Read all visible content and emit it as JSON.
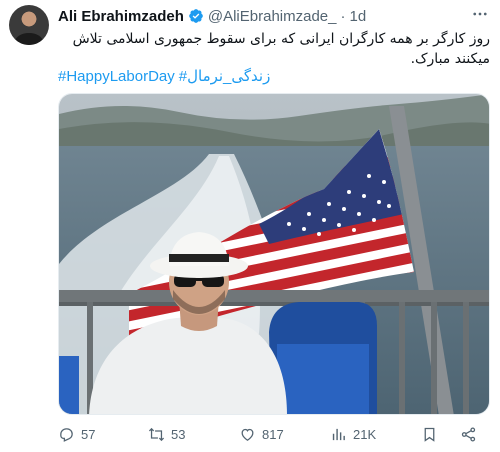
{
  "author": {
    "name": "Ali Ebrahimzadeh",
    "handle": "@AliEbrahimzade_",
    "separator": "·",
    "time": "1d"
  },
  "text": "روز کارگر بر همه کارگران ایرانی که برای سقوط جمهوری اسلامی تلاش میکنند مبارک.",
  "hashtags": [
    "#HappyLaborDay",
    "#زندگی_نرمال"
  ],
  "actions": {
    "replies": "57",
    "reposts": "53",
    "likes": "817",
    "views": "21K"
  },
  "icons": {
    "verified": "verified-badge-icon",
    "more": "more-options-icon",
    "reply": "reply-icon",
    "repost": "repost-icon",
    "like": "heart-icon",
    "views": "views-chart-icon",
    "bookmark": "bookmark-icon",
    "share": "share-icon"
  },
  "colors": {
    "link": "#1d9bf0",
    "muted": "#536471",
    "verified": "#1d9bf0"
  }
}
